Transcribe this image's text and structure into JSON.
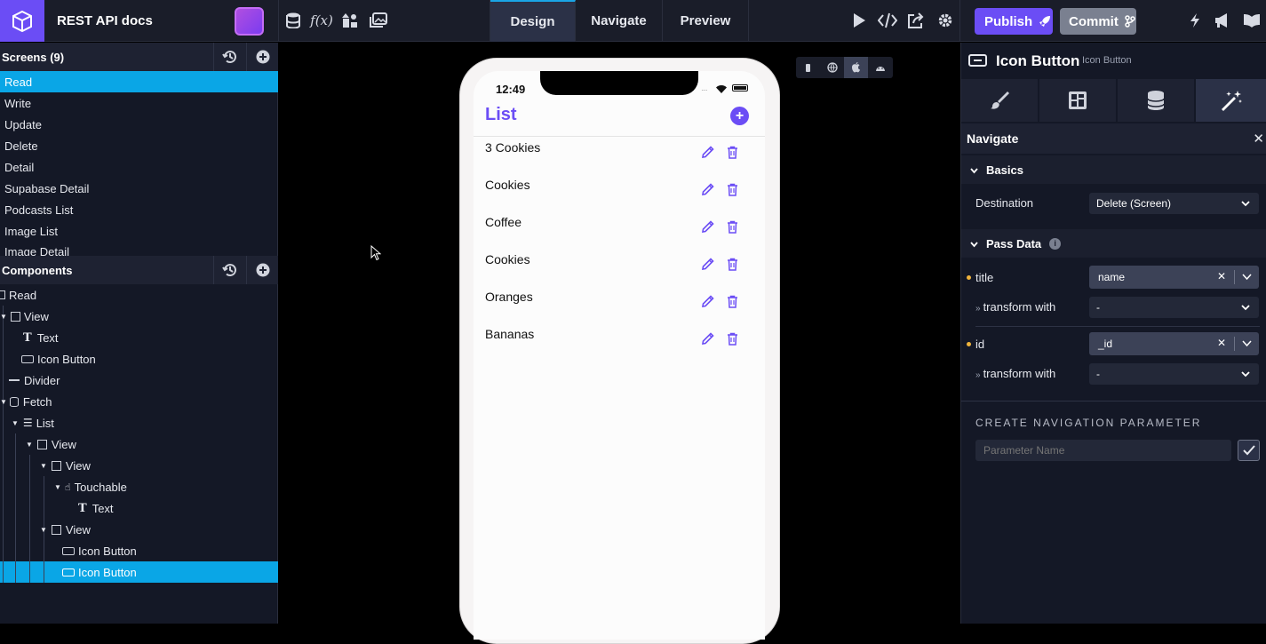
{
  "topbar": {
    "project_title": "REST API docs",
    "tabs": [
      "Design",
      "Navigate",
      "Preview"
    ],
    "active_tab": "Design",
    "publish_label": "Publish",
    "commit_label": "Commit"
  },
  "screens_panel": {
    "title": "Screens (9)",
    "items": [
      "Read",
      "Write",
      "Update",
      "Delete",
      "Detail",
      "Supabase Detail",
      "Podcasts List",
      "Image List",
      "Image Detail"
    ],
    "selected": "Read"
  },
  "components_panel": {
    "title": "Components",
    "tree": [
      {
        "label": "Read",
        "icon": "screen-icon"
      },
      {
        "label": "View",
        "icon": "view-icon"
      },
      {
        "label": "Text",
        "icon": "text-icon"
      },
      {
        "label": "Icon Button",
        "icon": "icon-button-icon"
      },
      {
        "label": "Divider",
        "icon": "divider-icon"
      },
      {
        "label": "Fetch",
        "icon": "database-icon"
      },
      {
        "label": "List",
        "icon": "list-icon"
      },
      {
        "label": "View",
        "icon": "view-icon"
      },
      {
        "label": "View",
        "icon": "view-icon"
      },
      {
        "label": "Touchable",
        "icon": "touch-icon"
      },
      {
        "label": "Text",
        "icon": "text-icon"
      },
      {
        "label": "View",
        "icon": "view-icon"
      },
      {
        "label": "Icon Button",
        "icon": "icon-button-icon"
      },
      {
        "label": "Icon Button",
        "icon": "icon-button-icon"
      }
    ]
  },
  "phone": {
    "time": "12:49",
    "title": "List",
    "items": [
      "3 Cookies",
      "Cookies",
      "Coffee",
      "Cookies",
      "Oranges",
      "Bananas"
    ],
    "accent_color": "#6b4df5"
  },
  "inspector": {
    "title": "Icon Button",
    "subtitle": "Icon Button",
    "section": "Navigate",
    "basics_label": "Basics",
    "destination_label": "Destination",
    "destination_value": "Delete (Screen)",
    "pass_data_label": "Pass Data",
    "params": [
      {
        "name": "title",
        "value": "name",
        "transform_label": "transform with",
        "transform_value": "-"
      },
      {
        "name": "id",
        "value": "_id",
        "transform_label": "transform with",
        "transform_value": "-"
      }
    ],
    "create_param_heading": "CREATE NAVIGATION PARAMETER",
    "param_placeholder": "Parameter Name"
  }
}
